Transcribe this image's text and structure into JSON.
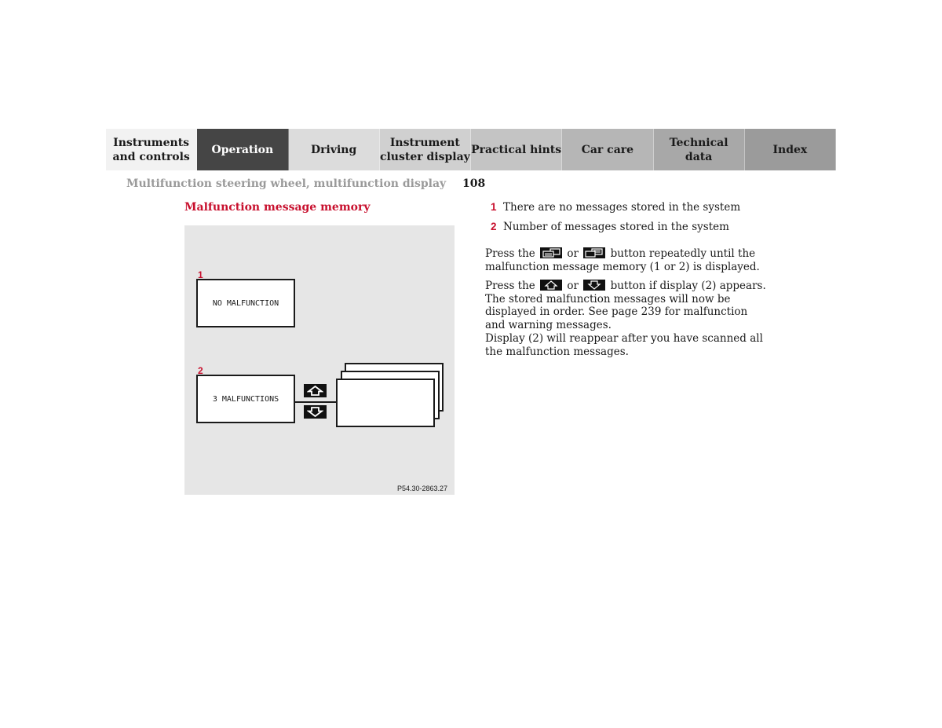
{
  "tabs": [
    {
      "label": "Instruments\nand controls",
      "color": "#f2f2f2",
      "active": false
    },
    {
      "label": "Operation",
      "color": "#454545",
      "active": true
    },
    {
      "label": "Driving",
      "color": "#dcdcdc",
      "active": false
    },
    {
      "label": "Instrument\ncluster display",
      "color": "#d0d0d0",
      "active": false
    },
    {
      "label": "Practical hints",
      "color": "#c4c4c4",
      "active": false
    },
    {
      "label": "Car care",
      "color": "#b6b6b6",
      "active": false
    },
    {
      "label": "Technical\ndata",
      "color": "#a8a8a8",
      "active": false
    },
    {
      "label": "Index",
      "color": "#9b9b9b",
      "active": false
    }
  ],
  "header": {
    "section": "Multifunction steering wheel, multifunction display",
    "page_number": "108"
  },
  "heading": "Malfunction message memory",
  "figure": {
    "callout_1": "1",
    "callout_2": "2",
    "display_1_text": "NO MALFUNCTION",
    "display_2_text": "3 MALFUNCTIONS",
    "up_button_icon": "arrow-up-icon",
    "down_button_icon": "arrow-down-icon",
    "code": "P54.30-2863.27"
  },
  "legend": [
    {
      "num": "1",
      "text": "There are no messages stored in the system"
    },
    {
      "num": "2",
      "text": "Number of messages stored in the system"
    }
  ],
  "paragraphs": {
    "p1_a": "Press the",
    "p1_or": "or",
    "p1_b": "button repeatedly until the malfunction message memory (1 or 2) is displayed.",
    "p2_a": "Press the",
    "p2_or": "or",
    "p2_b": "button if display (2) appears. The stored malfunction messages will now be displayed in order. See page 239 for malfunction and warning messages.",
    "p3": "Display (2) will reappear after you have scanned all the malfunction messages."
  },
  "colors": {
    "accent_red": "#c8102e",
    "header_gray": "#9a9a9a",
    "figure_bg": "#e6e6e6"
  }
}
